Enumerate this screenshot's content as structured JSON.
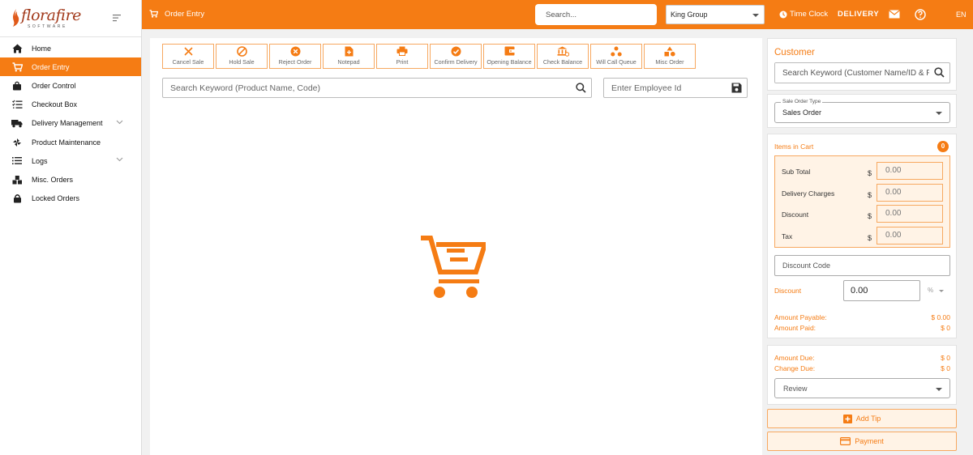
{
  "brand": {
    "name": "florafire",
    "tagline": "SOFTWARE"
  },
  "sidebar": {
    "items": [
      {
        "label": "Home",
        "icon": "home-icon",
        "active": false,
        "expandable": false
      },
      {
        "label": "Order Entry",
        "icon": "cart-icon",
        "active": true,
        "expandable": false
      },
      {
        "label": "Order Control",
        "icon": "bag-icon",
        "active": false,
        "expandable": false
      },
      {
        "label": "Checkout Box",
        "icon": "checklist-icon",
        "active": false,
        "expandable": false
      },
      {
        "label": "Delivery Management",
        "icon": "truck-icon",
        "active": false,
        "expandable": true
      },
      {
        "label": "Product Maintenance",
        "icon": "flower-icon",
        "active": false,
        "expandable": false
      },
      {
        "label": "Logs",
        "icon": "list-icon",
        "active": false,
        "expandable": true
      },
      {
        "label": "Misc. Orders",
        "icon": "boxes-icon",
        "active": false,
        "expandable": false
      },
      {
        "label": "Locked Orders",
        "icon": "lock-icon",
        "active": false,
        "expandable": false
      }
    ]
  },
  "topbar": {
    "title": "Order Entry",
    "search_placeholder": "Search...",
    "group": "King Group",
    "time_clock": "Time Clock",
    "delivery": "DELIVERY",
    "language": "EN"
  },
  "actions": [
    {
      "label": "Cancel Sale",
      "icon": "x-icon"
    },
    {
      "label": "Hold Sale",
      "icon": "ban-icon"
    },
    {
      "label": "Reject Order",
      "icon": "x-circle-icon"
    },
    {
      "label": "Notepad",
      "icon": "note-add-icon"
    },
    {
      "label": "Print",
      "icon": "printer-icon"
    },
    {
      "label": "Confirm Delivery",
      "icon": "check-circle-icon"
    },
    {
      "label": "Opening Balance",
      "icon": "wallet-icon"
    },
    {
      "label": "Check Balance",
      "icon": "bank-icon"
    },
    {
      "label": "Will Call Queue",
      "icon": "people-queue-icon"
    },
    {
      "label": "Misc Order",
      "icon": "shapes-icon"
    }
  ],
  "main": {
    "product_search_placeholder": "Search Keyword (Product Name, Code)",
    "employee_placeholder": "Enter Employee Id"
  },
  "customer": {
    "title": "Customer",
    "search_placeholder": "Search Keyword (Customer Name/ID & Phone)"
  },
  "order_type": {
    "label": "Sale Order Type",
    "value": "Sales Order"
  },
  "cart": {
    "items_label": "Items in Cart",
    "count": "0",
    "currency": "$",
    "totals": [
      {
        "label": "Sub Total",
        "value": "0.00"
      },
      {
        "label": "Delivery Charges",
        "value": "0.00"
      },
      {
        "label": "Discount",
        "value": "0.00"
      },
      {
        "label": "Tax",
        "value": "0.00"
      }
    ],
    "discount_code_placeholder": "Discount Code",
    "discount_label": "Discount",
    "discount_value": "0.00",
    "discount_type": "%",
    "amount_payable_label": "Amount Payable:",
    "amount_payable": "$ 0.00",
    "amount_paid_label": "Amount Paid:",
    "amount_paid": "$ 0"
  },
  "due": {
    "amount_due_label": "Amount Due:",
    "amount_due": "$ 0",
    "change_due_label": "Change Due:",
    "change_due": "$ 0",
    "review": "Review"
  },
  "buttons": {
    "add_tip": "Add Tip",
    "payment": "Payment"
  },
  "colors": {
    "accent": "#f57c14",
    "accent_light": "#fff3e6",
    "accent_border": "#f7a860"
  }
}
